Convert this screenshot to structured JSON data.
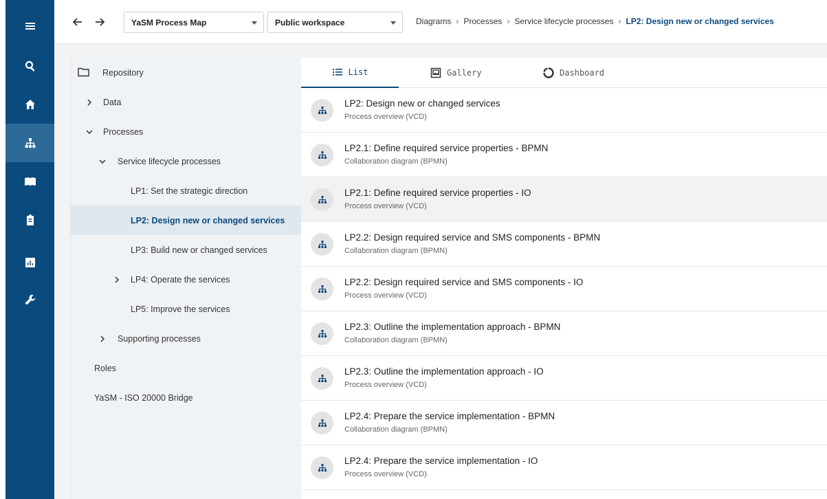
{
  "rail": {
    "items": [
      {
        "icon": "menu-icon"
      },
      {
        "icon": "search-icon"
      },
      {
        "icon": "home-icon"
      },
      {
        "icon": "sitemap-icon",
        "active": true
      },
      {
        "icon": "book-icon"
      },
      {
        "icon": "clipboard-icon"
      },
      {
        "icon": "chart-icon"
      },
      {
        "icon": "wrench-icon"
      }
    ]
  },
  "topbar": {
    "back_icon": "arrow-left-icon",
    "forward_icon": "arrow-right-icon",
    "map_select": "YaSM Process Map",
    "workspace_select": "Public workspace",
    "breadcrumbs": [
      "Diagrams",
      "Processes",
      "Service lifecycle processes",
      "LP2: Design new or changed services"
    ],
    "breadcrumb_separator": "›"
  },
  "tree": {
    "root": "Repository",
    "items": [
      {
        "label": "Data",
        "chevron": "right"
      },
      {
        "label": "Processes",
        "chevron": "down"
      },
      {
        "label": "Service lifecycle processes",
        "chevron": "down"
      },
      {
        "label": "LP1: Set the strategic direction"
      },
      {
        "label": "LP2: Design new or changed services",
        "selected": true
      },
      {
        "label": "LP3: Build new or changed services"
      },
      {
        "label": "LP4: Operate the services",
        "chevron": "right"
      },
      {
        "label": "LP5: Improve the services"
      },
      {
        "label": "Supporting processes",
        "chevron": "right"
      },
      {
        "label": "Roles"
      },
      {
        "label": "YaSM - ISO 20000 Bridge"
      }
    ]
  },
  "tabs": [
    {
      "label": "List",
      "icon": "list-icon",
      "active": true
    },
    {
      "label": "Gallery",
      "icon": "gallery-icon"
    },
    {
      "label": "Dashboard",
      "icon": "dashboard-icon"
    }
  ],
  "list": [
    {
      "title": "LP2: Design new or changed services",
      "subtitle": "Process overview (VCD)"
    },
    {
      "title": "LP2.1: Define required service properties - BPMN",
      "subtitle": "Collaboration diagram (BPMN)"
    },
    {
      "title": "LP2.1: Define required service properties - IO",
      "subtitle": "Process overview (VCD)",
      "hover": true
    },
    {
      "title": "LP2.2: Design required service and SMS components - BPMN",
      "subtitle": "Collaboration diagram (BPMN)"
    },
    {
      "title": "LP2.2: Design required service and SMS components - IO",
      "subtitle": "Process overview (VCD)"
    },
    {
      "title": "LP2.3: Outline the implementation approach - BPMN",
      "subtitle": "Collaboration diagram (BPMN)"
    },
    {
      "title": "LP2.3: Outline the implementation approach - IO",
      "subtitle": "Process overview (VCD)"
    },
    {
      "title": "LP2.4: Prepare the service implementation - BPMN",
      "subtitle": "Collaboration diagram (BPMN)"
    },
    {
      "title": "LP2.4: Prepare the service implementation - IO",
      "subtitle": "Process overview (VCD)"
    }
  ],
  "colors": {
    "brand": "#0b4a7d",
    "rail_active": "#2e6a98",
    "selected_row": "#dfe7ef"
  }
}
